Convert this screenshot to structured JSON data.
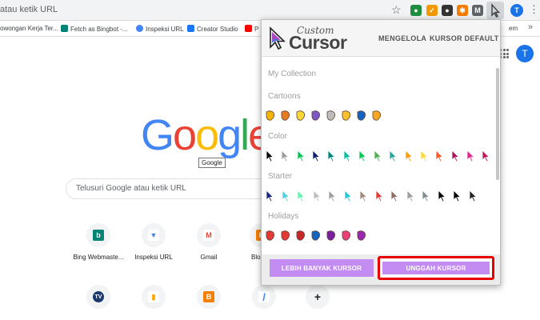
{
  "browser": {
    "address_text": "atau ketik URL",
    "avatar_letter": "T",
    "extensions": [
      {
        "name": "ext-1",
        "color": "#1e8e3e"
      },
      {
        "name": "ext-2",
        "color": "#f29900"
      },
      {
        "name": "ext-3",
        "color": "#333333"
      },
      {
        "name": "ext-4",
        "color": "#f57c00"
      },
      {
        "name": "ext-5",
        "color": "#5f6368"
      }
    ]
  },
  "bookmarks": [
    {
      "label": "owongan Kerja Ter...",
      "icon": "bookmark-icon"
    },
    {
      "label": "Fetch as Bingbot -...",
      "icon": "bing-icon"
    },
    {
      "label": "Inspeksi URL",
      "icon": "search-console-icon"
    },
    {
      "label": "Creator Studio",
      "icon": "facebook-icon"
    },
    {
      "label": "P",
      "icon": "youtube-icon"
    },
    {
      "label": "em",
      "icon": "bookmark-icon"
    }
  ],
  "newtab": {
    "logo_letters": [
      "G",
      "o",
      "o",
      "g",
      "l",
      "e"
    ],
    "logo_tooltip": "Google",
    "search_placeholder": "Telusuri Google atau ketik URL",
    "avatar_letter": "T",
    "tiles_row1": [
      {
        "label": "Bing Webmaste...",
        "icon": "bing-icon",
        "color": "#008373",
        "glyph": "b"
      },
      {
        "label": "Inspeksi URL",
        "icon": "search-console-icon",
        "color": "#4285f4",
        "glyph": "▼"
      },
      {
        "label": "Gmail",
        "icon": "gmail-icon",
        "color": "#ea4335",
        "glyph": "M"
      },
      {
        "label": "Blo",
        "icon": "blogger-icon",
        "color": "#f57d00",
        "glyph": "B"
      }
    ],
    "tiles_row2": [
      {
        "label": "",
        "icon": "tv-icon",
        "color": "#1a3a6e",
        "glyph": "TV"
      },
      {
        "label": "",
        "icon": "analytics-icon",
        "color": "#f9ab00",
        "glyph": "▮"
      },
      {
        "label": "",
        "icon": "blogger-icon",
        "color": "#f57d00",
        "glyph": "B"
      },
      {
        "label": "",
        "icon": "adsense-icon",
        "color": "#4285f4",
        "glyph": "/"
      },
      {
        "label": "",
        "icon": "add-shortcut-icon",
        "color": "#202124",
        "glyph": "+"
      }
    ]
  },
  "popup": {
    "brand_small": "Custom",
    "brand_big": "Cursor",
    "nav": {
      "manage": "MENGELOLA",
      "default": "KURSOR DEFAULT"
    },
    "sections": {
      "my_collection": "My Collection",
      "cartoons": "Cartoons",
      "color": "Color",
      "starter": "Starter",
      "holidays": "Holidays"
    },
    "cartoon_colors": [
      "#f4b400",
      "#e67c22",
      "#fdd835",
      "#7e57c2",
      "#bdbdbd",
      "#fbc02d",
      "#1565c0",
      "#f9a825"
    ],
    "color_cursors": [
      "#000000",
      "#9e9e9e",
      "#00c853",
      "#0d1b6e",
      "#00897b",
      "#00bfa5",
      "#00c853",
      "#4caf50",
      "#26a69a",
      "#ff9800",
      "#fdd835",
      "#ff5722",
      "#ad1457",
      "#e91e8c",
      "#c2185b"
    ],
    "starter_cursors": [
      "#1a237e",
      "#4dd0e1",
      "#69f0ae",
      "#bdbdbd",
      "#9e9e9e",
      "#26c6da",
      "#a1887f",
      "#e53935",
      "#8d6e63",
      "#9e9e9e",
      "#7f8c8d",
      "#000000",
      "#000000",
      "#212121"
    ],
    "holiday_colors": [
      "#e53935",
      "#e53935",
      "#c62828",
      "#1565c0",
      "#7b1fa2",
      "#ec407a",
      "#9c27b0"
    ],
    "buttons": {
      "more": "LEBIH BANYAK KURSOR",
      "upload": "UNGGAH KURSOR"
    },
    "accent": "#c38cf2",
    "highlight_color": "#e80000"
  }
}
